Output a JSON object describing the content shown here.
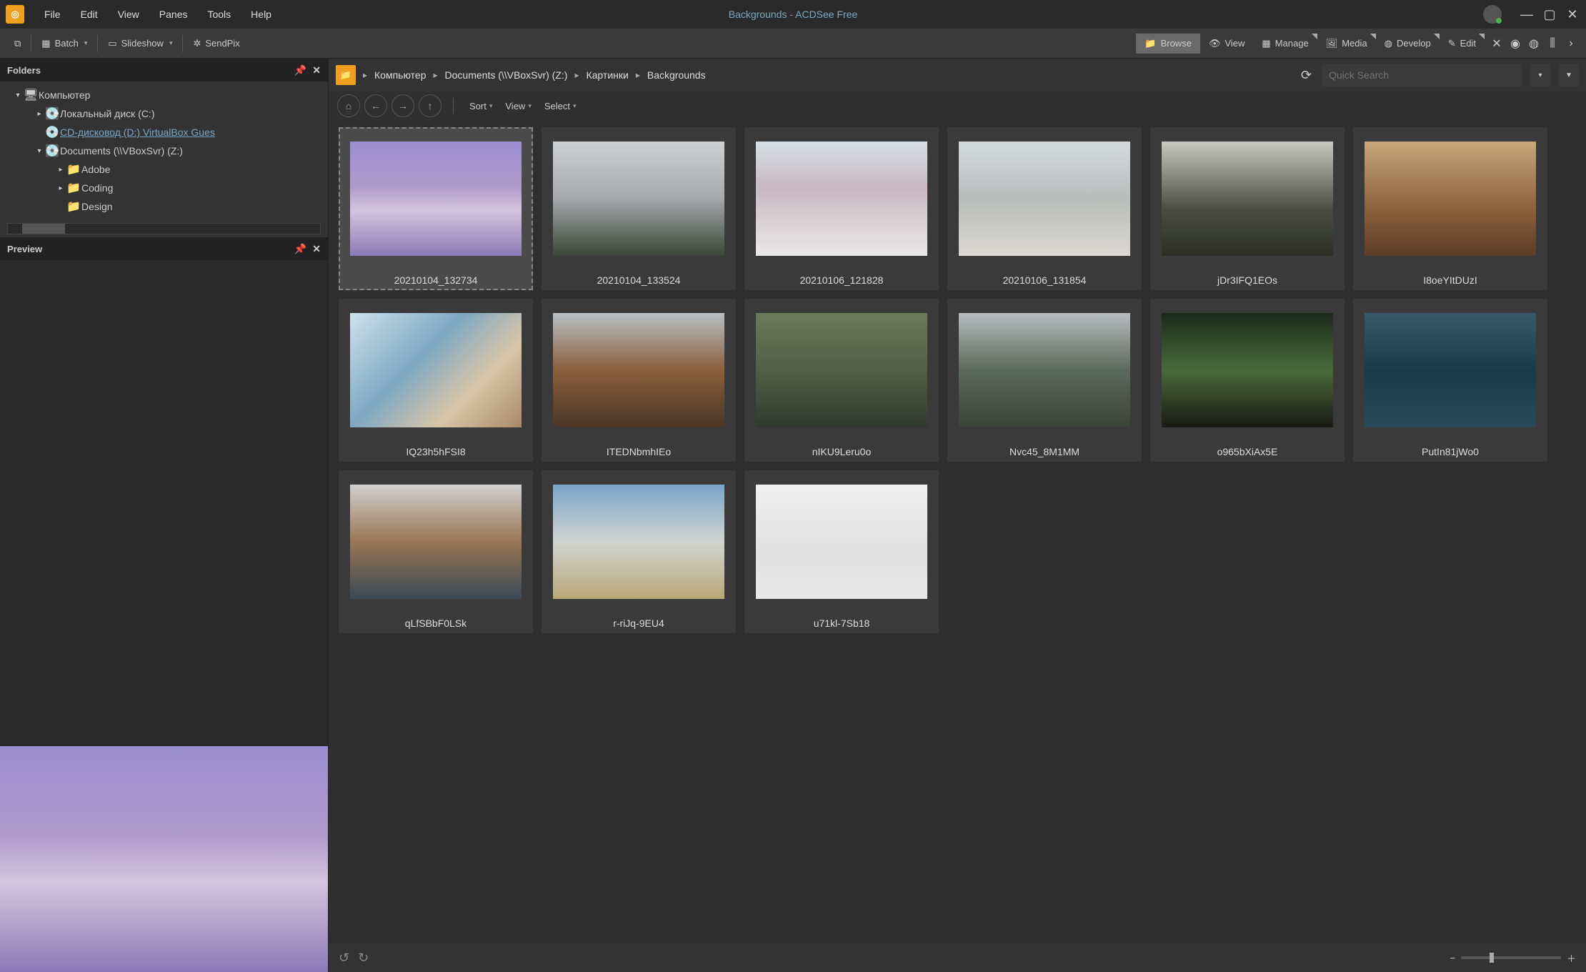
{
  "title": "Backgrounds - ACDSee Free",
  "menu": [
    "File",
    "Edit",
    "View",
    "Panes",
    "Tools",
    "Help"
  ],
  "toolbar": {
    "batch": "Batch",
    "slideshow": "Slideshow",
    "sendpix": "SendPix"
  },
  "modes": {
    "browse": "Browse",
    "view": "View",
    "manage": "Manage",
    "media": "Media",
    "develop": "Develop",
    "edit": "Edit"
  },
  "panels": {
    "folders": "Folders",
    "preview": "Preview"
  },
  "tree": [
    {
      "lv": 0,
      "exp": "▾",
      "ico": "computer",
      "label": "Компьютер"
    },
    {
      "lv": 1,
      "exp": "▸",
      "ico": "disk",
      "label": "Локальный диск (C:)"
    },
    {
      "lv": 1,
      "exp": "",
      "ico": "cd",
      "label": "CD-дисковод (D:) VirtualBox Gues",
      "link": true
    },
    {
      "lv": 1,
      "exp": "▾",
      "ico": "disk",
      "label": "Documents (\\\\VBoxSvr) (Z:)"
    },
    {
      "lv": 2,
      "exp": "▸",
      "ico": "folder",
      "label": "Adobe"
    },
    {
      "lv": 2,
      "exp": "▸",
      "ico": "folder",
      "label": "Coding"
    },
    {
      "lv": 2,
      "exp": "",
      "ico": "folder",
      "label": "Design"
    }
  ],
  "breadcrumb": [
    "Компьютер",
    "Documents (\\\\VBoxSvr) (Z:)",
    "Картинки",
    "Backgrounds"
  ],
  "search_placeholder": "Quick Search",
  "navtools": {
    "sort": "Sort",
    "view": "View",
    "select": "Select"
  },
  "thumbs": [
    {
      "name": "20210104_132734",
      "grad": "linear-gradient(180deg,#9a8fd0 0%,#b09acc 40%,#d5c5dd 60%,#8a7bb8 100%)",
      "selected": true
    },
    {
      "name": "20210104_133524",
      "grad": "linear-gradient(180deg,#cfd0d4 0%,#a6a8ac 50%,#3b4638 100%)"
    },
    {
      "name": "20210106_121828",
      "grad": "linear-gradient(180deg,#d6e0e6 0%,#c9b8bf 40%,#e8e8e8 100%)"
    },
    {
      "name": "20210106_131854",
      "grad": "linear-gradient(180deg,#d4dadb 0%,#babcbb 50%,#d9d8d3 100%)"
    },
    {
      "name": "jDr3IFQ1EOs",
      "grad": "linear-gradient(180deg,#c9c9c4 0%,#494c3e 60%,#2d2f26 100%)"
    },
    {
      "name": "I8oeYItDUzI",
      "grad": "linear-gradient(180deg,#c8a87d 0%,#8a5f3b 60%,#5b3d28 100%)"
    },
    {
      "name": "IQ23h5hFSI8",
      "grad": "linear-gradient(135deg,#cfe2ea 0%,#7da8c2 40%,#d9c6a8 70%,#a88a6a 100%)"
    },
    {
      "name": "ITEDNbmhIEo",
      "grad": "linear-gradient(180deg,#b7bfc4 0%,#8a5f3b 50%,#4a3626 100%)"
    },
    {
      "name": "nIKU9Leru0o",
      "grad": "linear-gradient(180deg,#6a7a5c 0%,#4a5a42 60%,#2f3a2c 100%)"
    },
    {
      "name": "Nvc45_8M1MM",
      "grad": "linear-gradient(180deg,#b8bcc0 0%,#5a6a5a 50%,#3a4434 100%)"
    },
    {
      "name": "o965bXiAx5E",
      "grad": "linear-gradient(180deg,#1a2a1a 0%,#4a6a3a 50%,#1a1a14 100%)"
    },
    {
      "name": "PutIn81jWo0",
      "grad": "linear-gradient(180deg,#3a5a6a 0%,#1a3a4a 50%,#2a4a5a 100%)"
    },
    {
      "name": "qLfSBbF0LSk",
      "grad": "linear-gradient(180deg,#d0d0d0 0%,#9a7654 50%,#3a4a56 100%)"
    },
    {
      "name": "r-riJq-9EU4",
      "grad": "linear-gradient(180deg,#7aa4c8 0%,#d0d4d0 50%,#b8a878 100%)"
    },
    {
      "name": "u71kl-7Sb18",
      "grad": "linear-gradient(180deg,#f0f0f0 0%,#e0e0e0 60%,#e8e8e8 100%)"
    }
  ],
  "preview_grad": "linear-gradient(180deg,#9a8fd0 0%,#b09acc 40%,#d5c5dd 60%,#8a7bb8 100%)"
}
